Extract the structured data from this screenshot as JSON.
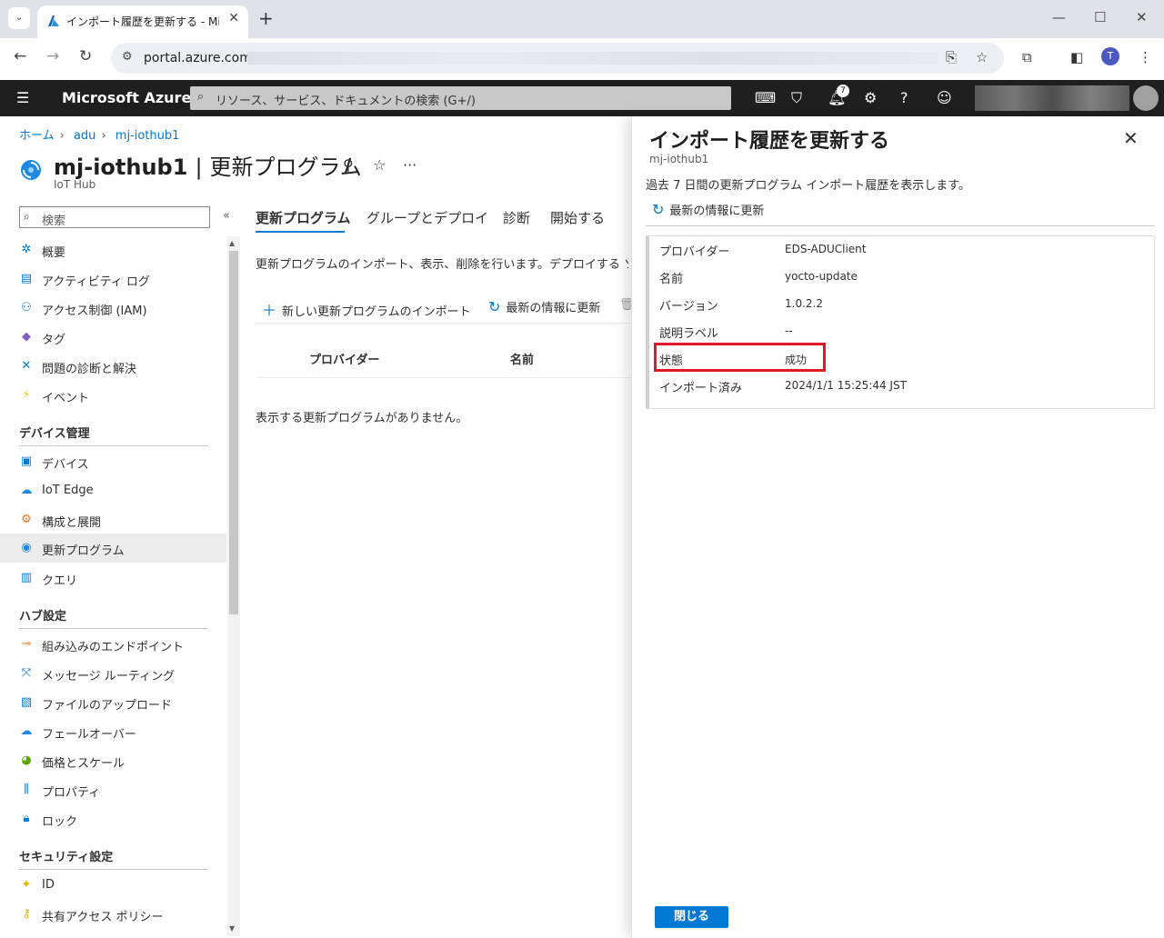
{
  "browser": {
    "tab_title": "インポート履歴を更新する - Micros",
    "url": "portal.azure.com/",
    "profile_initial": "T"
  },
  "azure": {
    "brand": "Microsoft Azure",
    "search_placeholder": "リソース、サービス、ドキュメントの検索 (G+/)",
    "notification_count": "7"
  },
  "breadcrumb": [
    "ホーム",
    "adu",
    "mj-iothub1"
  ],
  "resource": {
    "name": "mj-iothub1",
    "section": "更新プログラム",
    "type": "IoT Hub"
  },
  "left_nav": {
    "search_placeholder": "検索",
    "items_top": [
      "概要",
      "アクティビティ ログ",
      "アクセス制御 (IAM)",
      "タグ",
      "問題の診断と解決",
      "イベント"
    ],
    "group_device": "デバイス管理",
    "items_device": [
      "デバイス",
      "IoT Edge",
      "構成と展開",
      "更新プログラム",
      "クエリ"
    ],
    "group_hub": "ハブ設定",
    "items_hub": [
      "組み込みのエンドポイント",
      "メッセージ ルーティング",
      "ファイルのアップロード",
      "フェールオーバー",
      "価格とスケール",
      "プロパティ",
      "ロック"
    ],
    "group_security": "セキュリティ設定",
    "items_security": [
      "ID",
      "共有アクセス ポリシー"
    ]
  },
  "main": {
    "tabs": [
      "更新プログラム",
      "グループとデプロイ",
      "診断",
      "開始する"
    ],
    "description": "更新プログラムのインポート、表示、削除を行います。デプロイする ソ",
    "cmd_import": "新しい更新プログラムのインポート",
    "cmd_refresh": "最新の情報に更新",
    "columns": [
      "プロバイダー",
      "名前"
    ],
    "empty_message": "表示する更新プログラムがありません。"
  },
  "panel": {
    "title": "インポート履歴を更新する",
    "subtitle": "mj-iothub1",
    "description": "過去 7 日間の更新プログラム インポート履歴を表示します。",
    "refresh_label": "最新の情報に更新",
    "fields": [
      {
        "key": "プロバイダー",
        "value": "EDS-ADUClient"
      },
      {
        "key": "名前",
        "value": "yocto-update"
      },
      {
        "key": "バージョン",
        "value": "1.0.2.2"
      },
      {
        "key": "説明ラベル",
        "value": "--"
      },
      {
        "key": "状態",
        "value": "成功"
      },
      {
        "key": "インポート済み",
        "value": "2024/1/1 15:25:44 JST"
      }
    ],
    "close_button": "閉じる"
  }
}
